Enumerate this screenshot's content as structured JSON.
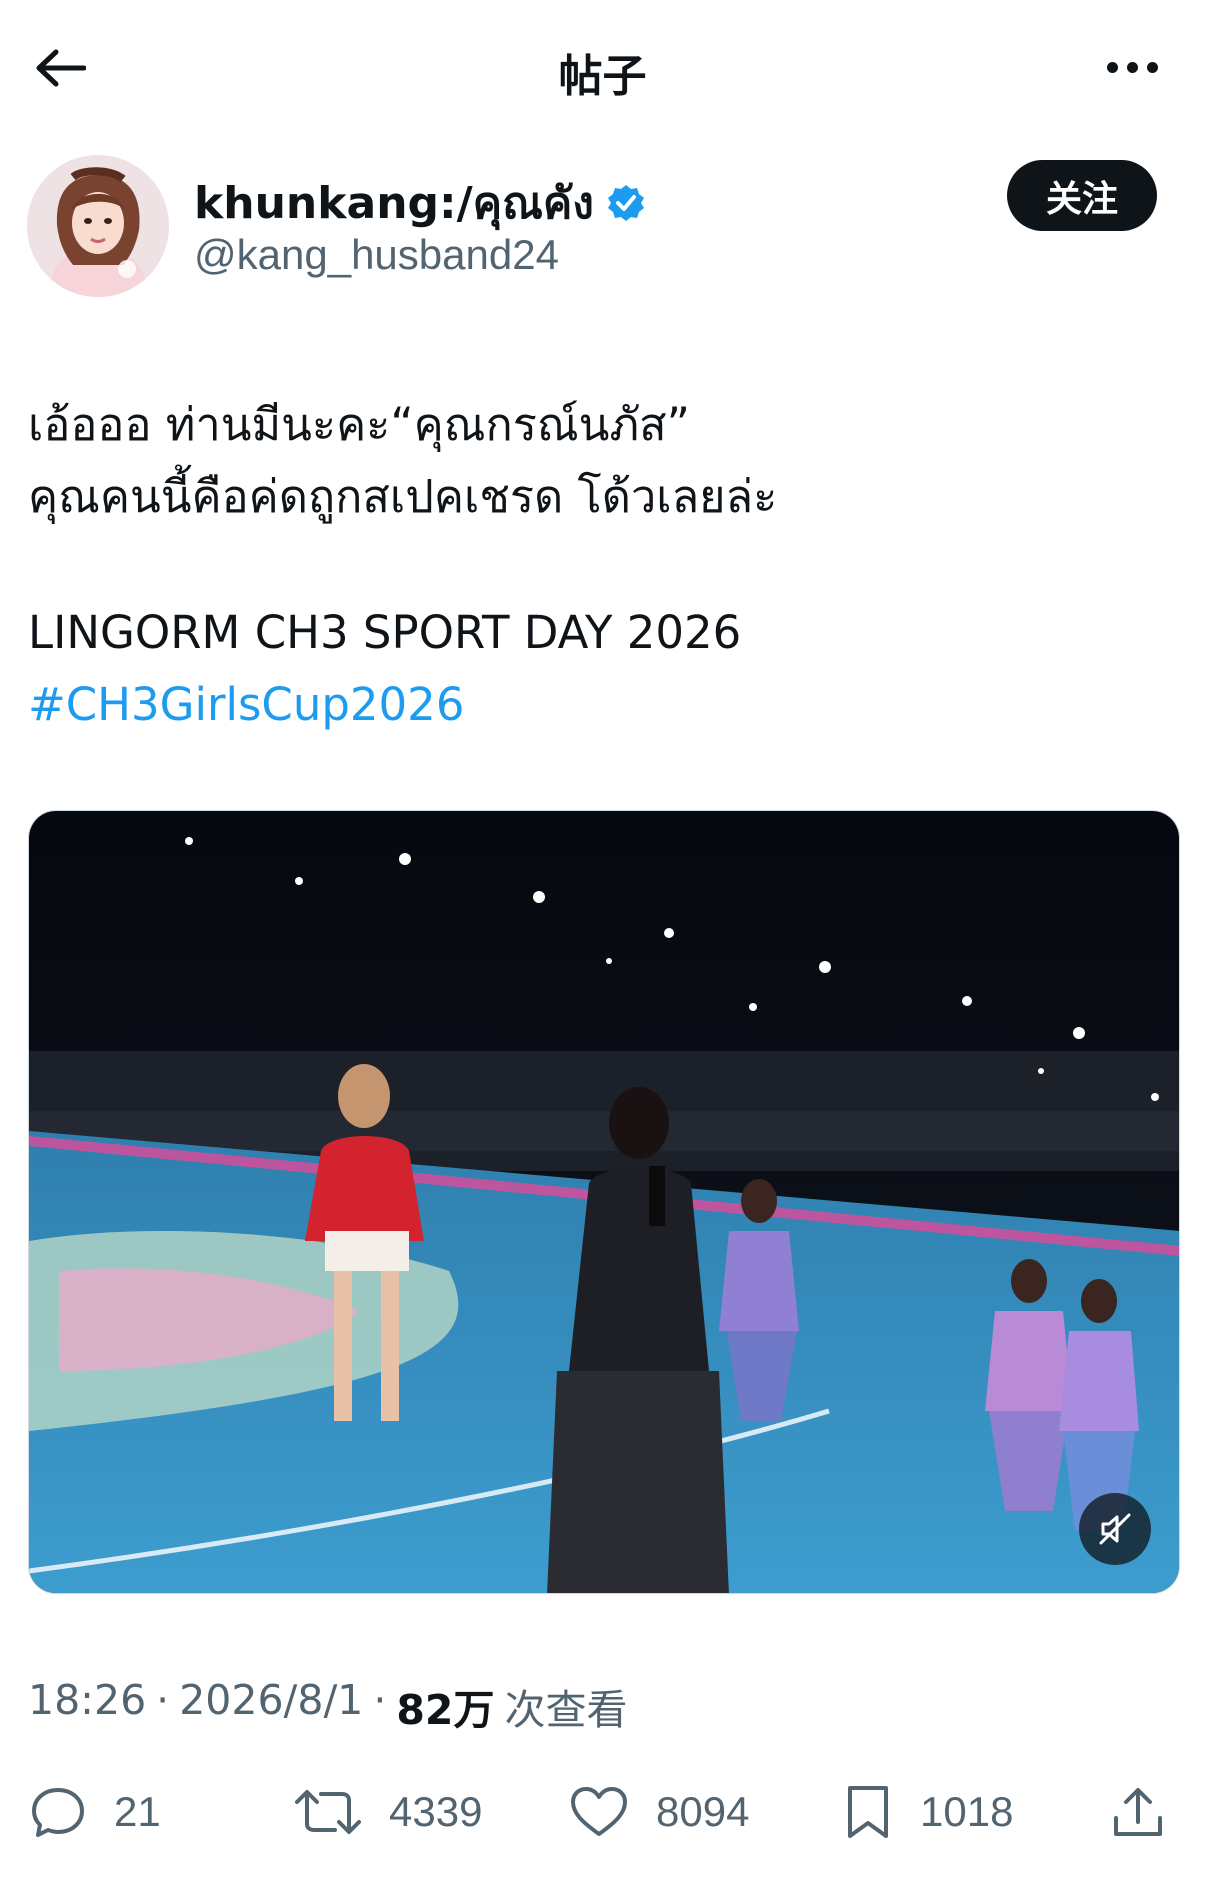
{
  "header": {
    "title": "帖子",
    "back_icon": "arrow-left-icon",
    "more_icon": "more-horizontal-icon"
  },
  "author": {
    "display_name": "khunkang:/คุณคัง",
    "handle": "@kang_husband24",
    "verified_icon": "verified-badge-icon",
    "follow_label": "关注"
  },
  "post": {
    "line1": "เอ้อออ ท่านมีนะคะ“คุณกรณ์นภัส”",
    "line2": "คุณคนนี้คือค่ดถูกสเปคเชรด โด้วเลยล่ะ",
    "line3": "LINGORM CH3 SPORT DAY 2026",
    "hashtag": "#CH3GirlsCup2026"
  },
  "media": {
    "type": "video",
    "muted_icon": "volume-muted-icon"
  },
  "meta": {
    "time": "18:26",
    "sep1": "·",
    "date": "2026/8/1",
    "sep2": "·",
    "views": "82万",
    "views_label": "次查看"
  },
  "actions": {
    "replies": "21",
    "reposts": "4339",
    "likes": "8094",
    "bookmarks": "1018",
    "icons": [
      "reply-icon",
      "repost-icon",
      "like-icon",
      "bookmark-icon",
      "share-icon"
    ]
  }
}
